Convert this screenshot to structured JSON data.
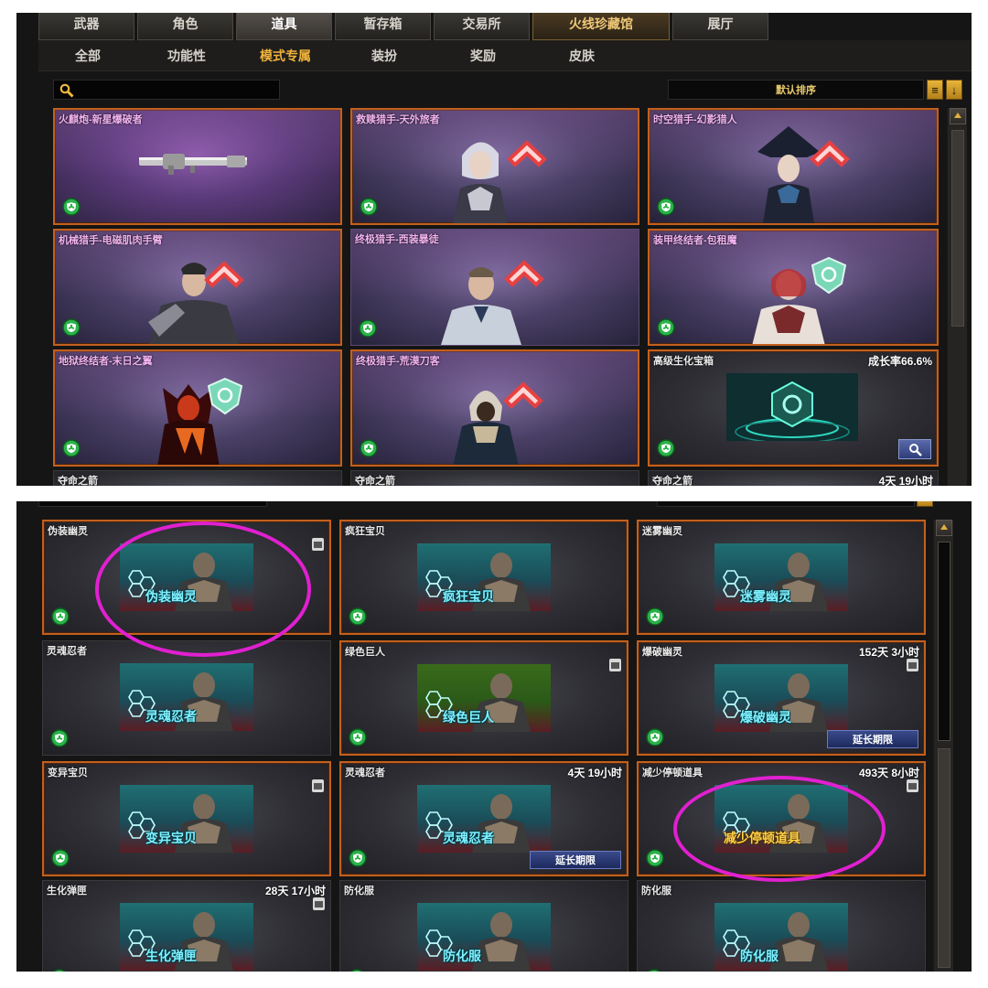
{
  "top": {
    "main_tabs": [
      "武器",
      "角色",
      "道具",
      "暂存箱",
      "交易所",
      "火线珍藏馆",
      "展厅"
    ],
    "sub_tabs": [
      "全部",
      "功能性",
      "模式专属",
      "装扮",
      "奖励",
      "皮肤"
    ],
    "sort_label": "默认排序",
    "cards": [
      {
        "title": "火麒炮-新星爆破者"
      },
      {
        "title": "救赎猎手-天外旅者"
      },
      {
        "title": "时空猎手-幻影猎人"
      },
      {
        "title": "机械猎手-电磁肌肉手臂"
      },
      {
        "title": "终极猎手-西装暴徒"
      },
      {
        "title": "装甲终结者-包租魔"
      },
      {
        "title": "地狱终结者-末日之翼"
      },
      {
        "title": "终极猎手-荒漠刀客"
      },
      {
        "title": "高级生化宝箱",
        "extra": "成长率66.6%"
      }
    ],
    "partial_row": [
      {
        "title": "夺命之箭"
      },
      {
        "title": "夺命之箭"
      },
      {
        "title": "夺命之箭",
        "time": "4天 19小时"
      }
    ]
  },
  "bottom": {
    "extend_label": "延长期限",
    "cards": [
      {
        "title": "伪装幽灵",
        "label": "伪装幽灵"
      },
      {
        "title": "疯狂宝贝",
        "label": "疯狂宝贝"
      },
      {
        "title": "迷雾幽灵",
        "label": "迷雾幽灵"
      },
      {
        "title": "灵魂忍者",
        "label": "灵魂忍者"
      },
      {
        "title": "绿色巨人",
        "label": "绿色巨人"
      },
      {
        "title": "爆破幽灵",
        "label": "爆破幽灵",
        "time": "152天 3小时"
      },
      {
        "title": "变异宝贝",
        "label": "变异宝贝"
      },
      {
        "title": "灵魂忍者",
        "label": "灵魂忍者",
        "time": "4天 19小时"
      },
      {
        "title": "减少停顿道具",
        "label": "减少停顿道具",
        "time": "493天 8小时"
      },
      {
        "title": "生化弹匣",
        "label": "生化弹匣",
        "time": "28天 17小时"
      },
      {
        "title": "防化服",
        "label": "防化服"
      },
      {
        "title": "防化服",
        "label": "防化服"
      }
    ]
  },
  "colors": {
    "active_tab": "#f2b43a",
    "card_border": "#c2601e",
    "highlight": "#e020d0"
  }
}
